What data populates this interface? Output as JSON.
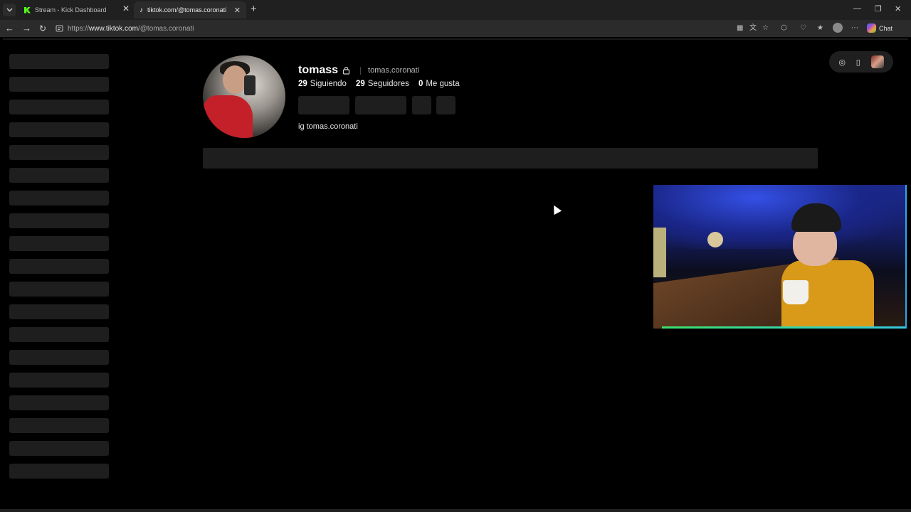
{
  "browser": {
    "tabs": [
      {
        "label": "Stream - Kick Dashboard",
        "active": false,
        "favicon": "kick-icon",
        "favicon_color": "#53fc18"
      },
      {
        "label": "tiktok.com/@tomas.coronati",
        "active": true,
        "favicon": "tiktok-icon"
      }
    ],
    "url": {
      "scheme": "https://",
      "host": "www.tiktok.com",
      "path": "/@tomas.coronati"
    },
    "copilot_label": "Chat"
  },
  "profile": {
    "username": "tomass",
    "handle": "tomas.coronati",
    "private": true,
    "stats": [
      {
        "value": "29",
        "label": "Siguiendo"
      },
      {
        "value": "29",
        "label": "Seguidores"
      },
      {
        "value": "0",
        "label": "Me gusta"
      }
    ],
    "bio": "ig tomas.coronati"
  },
  "colors": {
    "background": "#000000",
    "skeleton": "#1e1e1e",
    "chrome": "#202020",
    "webcam_border": "#2fa8e8"
  }
}
